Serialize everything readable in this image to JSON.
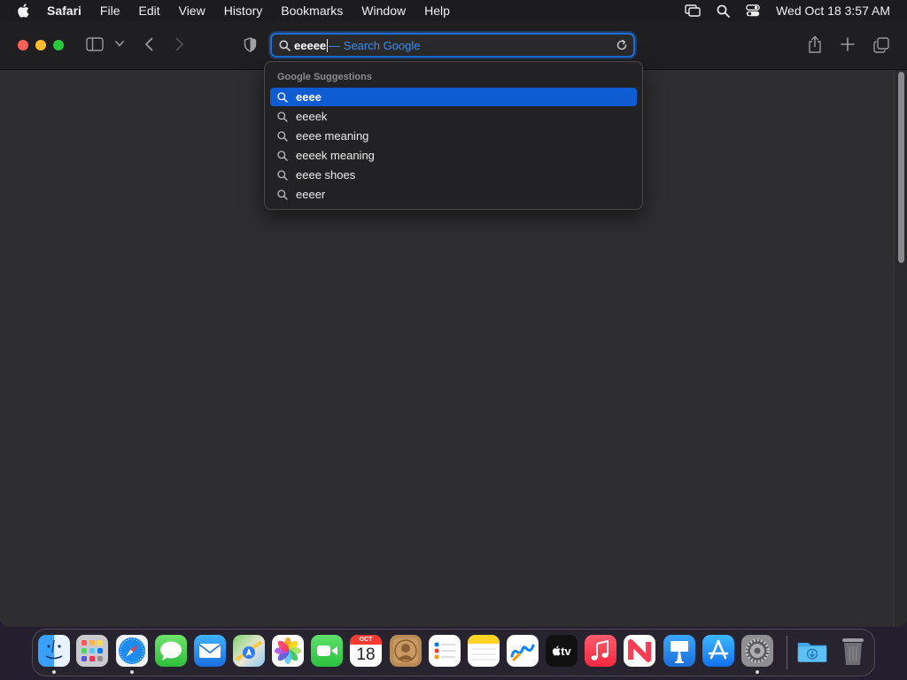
{
  "menubar": {
    "app_name": "Safari",
    "items": [
      "File",
      "Edit",
      "View",
      "History",
      "Bookmarks",
      "Window",
      "Help"
    ],
    "clock": "Wed Oct 18  3:57 AM",
    "status_icons": [
      "screen-mirroring-icon",
      "spotlight-search-icon",
      "control-center-icon"
    ]
  },
  "toolbar": {
    "icons": [
      "sidebar-toggle-icon",
      "tab-group-chevron-icon",
      "back-icon",
      "forward-icon",
      "privacy-report-shield-icon",
      "share-icon",
      "new-tab-icon",
      "tab-overview-icon"
    ]
  },
  "addressbar": {
    "typed_text": "eeeee",
    "completion_hint": "— Search Google"
  },
  "suggestions": {
    "header": "Google Suggestions",
    "items": [
      "eeee",
      "eeeek",
      "eeee meaning",
      "eeeek meaning",
      "eeee shoes",
      "eeeer"
    ],
    "selected_index": 0
  },
  "dock": {
    "apps": [
      "Finder",
      "Launchpad",
      "Safari",
      "Messages",
      "Mail",
      "Maps",
      "Photos",
      "FaceTime",
      "Calendar",
      "Contacts",
      "Reminders",
      "Notes",
      "Freeform",
      "TV",
      "Music",
      "News",
      "Keynote",
      "App Store",
      "System Settings",
      "Downloads",
      "Trash"
    ],
    "calendar_month": "OCT",
    "calendar_day": "18",
    "tv_label": "tv",
    "running": [
      "Finder",
      "Safari",
      "System Settings"
    ]
  },
  "colors": {
    "accent": "#0f5bd1",
    "hint": "#3d8ef0",
    "close": "#ff5f57",
    "minimize": "#febc2e",
    "zoom": "#28c840"
  }
}
